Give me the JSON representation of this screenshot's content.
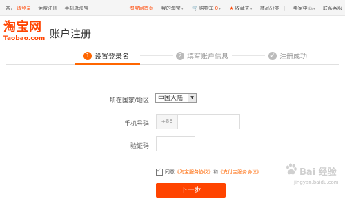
{
  "topbar": {
    "greeting": "亲，",
    "login": "请登录",
    "register": "免费注册",
    "mobile": "手机逛淘宝",
    "home": "淘宝网首页",
    "my_taobao": "我的淘宝",
    "cart": "购物车",
    "cart_count": "0",
    "favorites": "收藏夹",
    "categories": "商品分类",
    "seller_center": "卖家中心",
    "support": "联系客服"
  },
  "header": {
    "logo_text": "淘宝网",
    "logo_domain": "Taobao.com",
    "title": "账户注册"
  },
  "steps": [
    {
      "num": "1",
      "label": "设置登录名"
    },
    {
      "num": "2",
      "label": "填写账户信息"
    },
    {
      "num": "✓",
      "label": "注册成功"
    }
  ],
  "form": {
    "country_label": "所在国家/地区",
    "country_value": "中国大陆",
    "phone_label": "手机号码",
    "phone_code": "+86",
    "phone_value": "",
    "code_label": "验证码",
    "code_value": "",
    "agree_prefix": "同意",
    "agree_link1": "《淘宝服务协议》",
    "agree_and": "和",
    "agree_link2": "《支付宝服务协议》",
    "submit_label": "下一步"
  },
  "watermark": {
    "brand": "Bai 经验",
    "url": "jingyan.baidu.com"
  },
  "colors": {
    "accent": "#ff4400",
    "step_active": "#ff6600",
    "step_inactive": "#bbbbbb"
  }
}
